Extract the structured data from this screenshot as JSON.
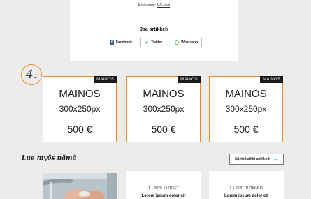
{
  "share": {
    "keywords_label": "Avainsanat:",
    "keyword": "MS-tauti",
    "title": "Jaa artikkeli",
    "buttons": [
      {
        "label": "Facebook",
        "icon": "facebook-icon"
      },
      {
        "label": "Twitter",
        "icon": "twitter-icon"
      },
      {
        "label": "Whatsapp",
        "icon": "whatsapp-icon"
      }
    ]
  },
  "step_number": "4.",
  "ads": [
    {
      "badge": "MAINOS",
      "title": "MAINOS",
      "size": "300x250px",
      "price": "500 €"
    },
    {
      "badge": "MAINOS",
      "title": "MAINOS",
      "size": "300x250px",
      "price": "500 €"
    },
    {
      "badge": "MAINOS",
      "title": "MAINOS",
      "size": "300x250px",
      "price": "500 €"
    }
  ],
  "read_more": {
    "heading": "Lue myös nämä",
    "see_all": "Näytä kaikki artikkelit"
  },
  "articles": [
    {
      "date": "1.1.2020",
      "category": "UUTISET",
      "title": "Lorem ipsum dolor sit"
    },
    {
      "date": "1.1.2020",
      "category": "TUTKIMUS",
      "title": "Lorem ipsum dolor sit"
    }
  ],
  "colors": {
    "accent": "#f08a24",
    "badge_bg": "#1a1a1a",
    "link_arrow": "#1e88e5"
  }
}
